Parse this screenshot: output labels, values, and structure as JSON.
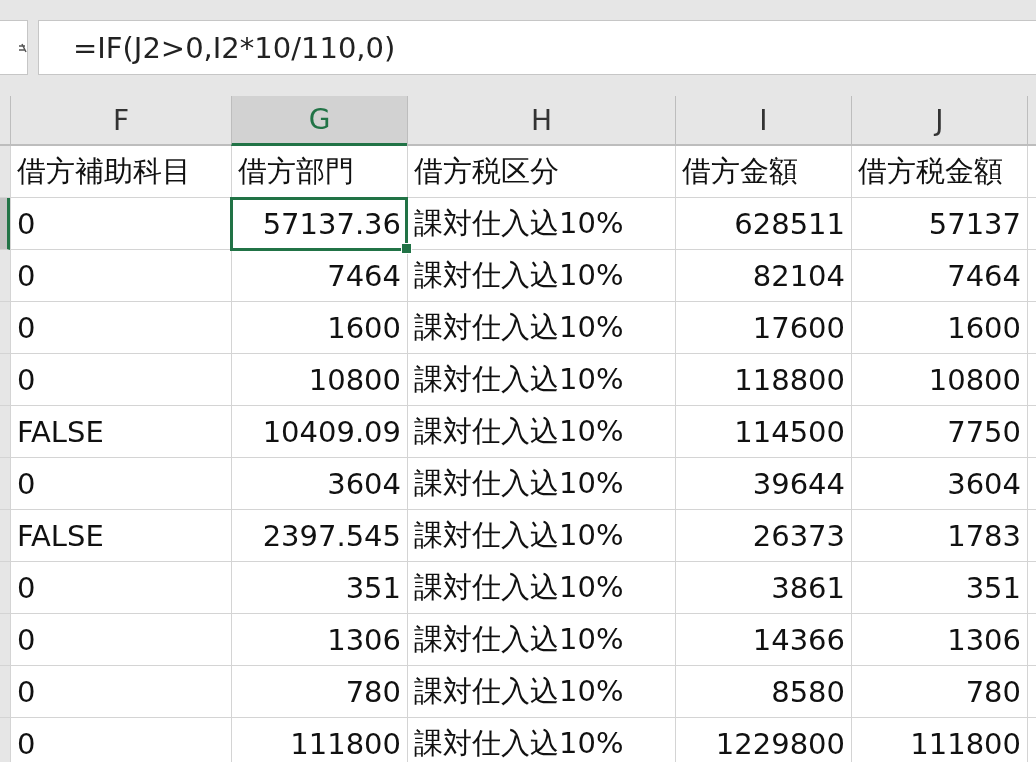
{
  "formula_bar": {
    "formula": "=IF(J2>0,I2*10/110,0)"
  },
  "columns": [
    {
      "letter": "F",
      "selected": false,
      "kind": "text"
    },
    {
      "letter": "G",
      "selected": true,
      "kind": "number"
    },
    {
      "letter": "H",
      "selected": false,
      "kind": "text"
    },
    {
      "letter": "I",
      "selected": false,
      "kind": "number"
    },
    {
      "letter": "J",
      "selected": false,
      "kind": "number"
    }
  ],
  "header_row": [
    "借方補助科目",
    "借方部門",
    "借方税区分",
    "借方金額",
    "借方税金額"
  ],
  "rows": [
    {
      "selected": true,
      "cells": [
        "0",
        "57137.36",
        "課対仕入込10%",
        "628511",
        "57137"
      ]
    },
    {
      "selected": false,
      "cells": [
        "0",
        "7464",
        "課対仕入込10%",
        "82104",
        "7464"
      ]
    },
    {
      "selected": false,
      "cells": [
        "0",
        "1600",
        "課対仕入込10%",
        "17600",
        "1600"
      ]
    },
    {
      "selected": false,
      "cells": [
        "0",
        "10800",
        "課対仕入込10%",
        "118800",
        "10800"
      ]
    },
    {
      "selected": false,
      "cells": [
        "FALSE",
        "10409.09",
        "課対仕入込10%",
        "114500",
        "7750"
      ]
    },
    {
      "selected": false,
      "cells": [
        "0",
        "3604",
        "課対仕入込10%",
        "39644",
        "3604"
      ]
    },
    {
      "selected": false,
      "cells": [
        "FALSE",
        "2397.545",
        "課対仕入込10%",
        "26373",
        "1783"
      ]
    },
    {
      "selected": false,
      "cells": [
        "0",
        "351",
        "課対仕入込10%",
        "3861",
        "351"
      ]
    },
    {
      "selected": false,
      "cells": [
        "0",
        "1306",
        "課対仕入込10%",
        "14366",
        "1306"
      ]
    },
    {
      "selected": false,
      "cells": [
        "0",
        "780",
        "課対仕入込10%",
        "8580",
        "780"
      ]
    },
    {
      "selected": false,
      "cells": [
        "0",
        "111800",
        "課対仕入込10%",
        "1229800",
        "111800"
      ]
    }
  ]
}
